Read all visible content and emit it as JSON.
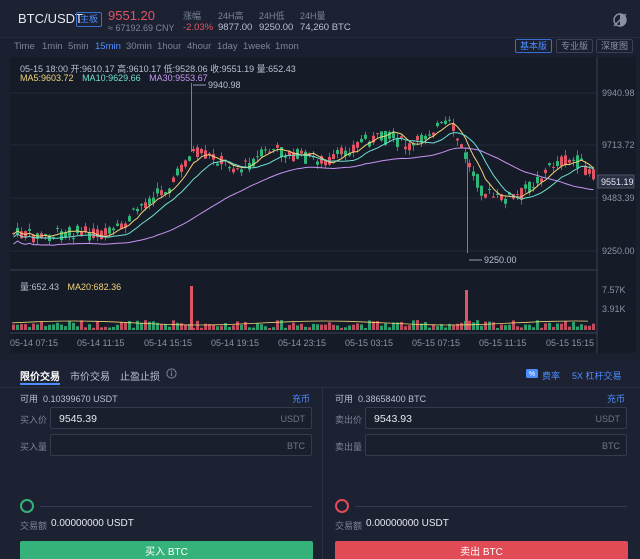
{
  "header": {
    "pair": "BTC/USDT",
    "main_badge": "主板",
    "last_price": "9551.20",
    "cny_price": "≈ 67192.69 CNY",
    "change_label": "涨幅",
    "change_value": "-2.03%",
    "high_label": "24H高",
    "high_value": "9877.00",
    "low_label": "24H低",
    "low_value": "9250.00",
    "volume_label": "24H量",
    "volume_value": "74,260 BTC"
  },
  "toolbar": {
    "timeframes": [
      "Time",
      "1min",
      "5min",
      "15min",
      "30min",
      "1hour",
      "4hour",
      "1day",
      "1week",
      "1mon"
    ],
    "active_timeframe": "15min",
    "views": [
      "基本版",
      "专业版",
      "深度图"
    ],
    "active_view": "基本版"
  },
  "chart": {
    "ohlc_line": "05-15 18:00  开:9610.17  高:9610.17  低:9528.06  收:9551.19  量:652.43",
    "ma5": "MA5:9603.72",
    "ma10": "MA10:9629.66",
    "ma30": "MA30:9553.67",
    "vol_label": "量:652.43",
    "vol_ma20": "MA20:682.36",
    "price_ticks": [
      "9940.98",
      "9713.72",
      "9483.39",
      "9250.00"
    ],
    "current_price": "9551.19",
    "high_marker": "9940.98",
    "low_marker": "9250.00",
    "volume_ticks": [
      "7.57K",
      "3.91K"
    ],
    "time_ticks": [
      "05-14 07:15",
      "05-14 11:15",
      "05-14 15:15",
      "05-14 19:15",
      "05-14 23:15",
      "05-15 03:15",
      "05-15 07:15",
      "05-15 11:15",
      "05-15 15:15"
    ],
    "colors": {
      "up": "#2fb77a",
      "down": "#e05566",
      "ma5": "#f2d47a",
      "ma10": "#6fe0d0",
      "ma30": "#c796f2"
    }
  },
  "trade": {
    "tabs": [
      "限价交易",
      "市价交易",
      "止盈止损"
    ],
    "active_tab": "限价交易",
    "rate_label": "费率",
    "leverage_label": "5X 杠杆交易",
    "buy": {
      "avail_label": "可用",
      "avail_value": "0.10399670 USDT",
      "deposit": "充币",
      "price_label": "买入价",
      "price_value": "9545.39",
      "price_unit": "USDT",
      "qty_label": "买入量",
      "qty_unit": "BTC",
      "amount_label": "交易额",
      "amount_value": "0.00000000 USDT",
      "button": "买入 BTC",
      "color": "#35b27a"
    },
    "sell": {
      "avail_label": "可用",
      "avail_value": "0.38658400 BTC",
      "deposit": "充币",
      "price_label": "卖出价",
      "price_value": "9543.93",
      "price_unit": "USDT",
      "qty_label": "卖出量",
      "qty_unit": "BTC",
      "amount_label": "交易额",
      "amount_value": "0.00000000 USDT",
      "button": "卖出 BTC",
      "color": "#e04b55"
    }
  }
}
